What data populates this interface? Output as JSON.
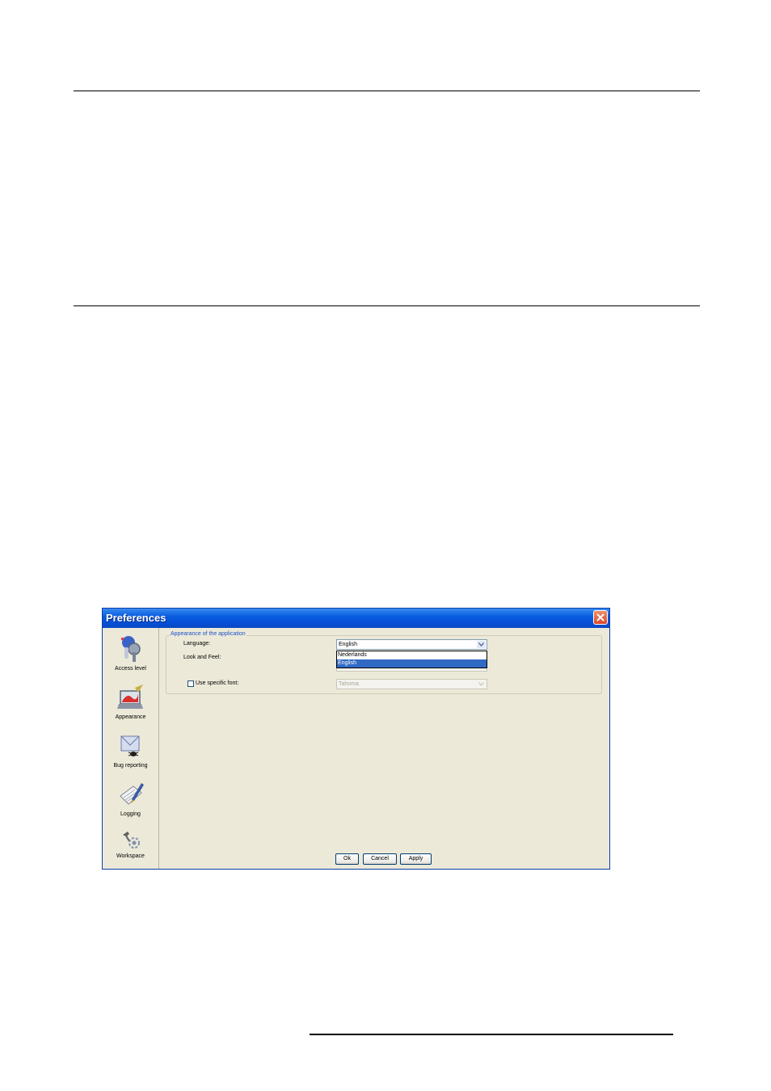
{
  "window": {
    "title": "Preferences"
  },
  "sidebar": {
    "items": [
      {
        "label": "Access level",
        "icon": "access-level-icon"
      },
      {
        "label": "Appearance",
        "icon": "appearance-icon"
      },
      {
        "label": "Bug reporting",
        "icon": "bug-reporting-icon"
      },
      {
        "label": "Logging",
        "icon": "logging-icon"
      },
      {
        "label": "Workspace",
        "icon": "workspace-icon"
      }
    ]
  },
  "appearance": {
    "group_title": "Appearance of the application",
    "language_label": "Language:",
    "language_value": "English",
    "language_options": [
      "Nederlands",
      "English"
    ],
    "look_and_feel_label": "Look and Feel:",
    "use_specific_font_label": "Use specific font:",
    "use_specific_font_checked": false,
    "font_value": "Tahoma"
  },
  "buttons": {
    "ok": "Ok",
    "cancel": "Cancel",
    "apply": "Apply"
  },
  "colors": {
    "titlebar": "#0650d8",
    "window_bg": "#ece9d8",
    "selection": "#316ac5",
    "group_title": "#1f52c8"
  }
}
